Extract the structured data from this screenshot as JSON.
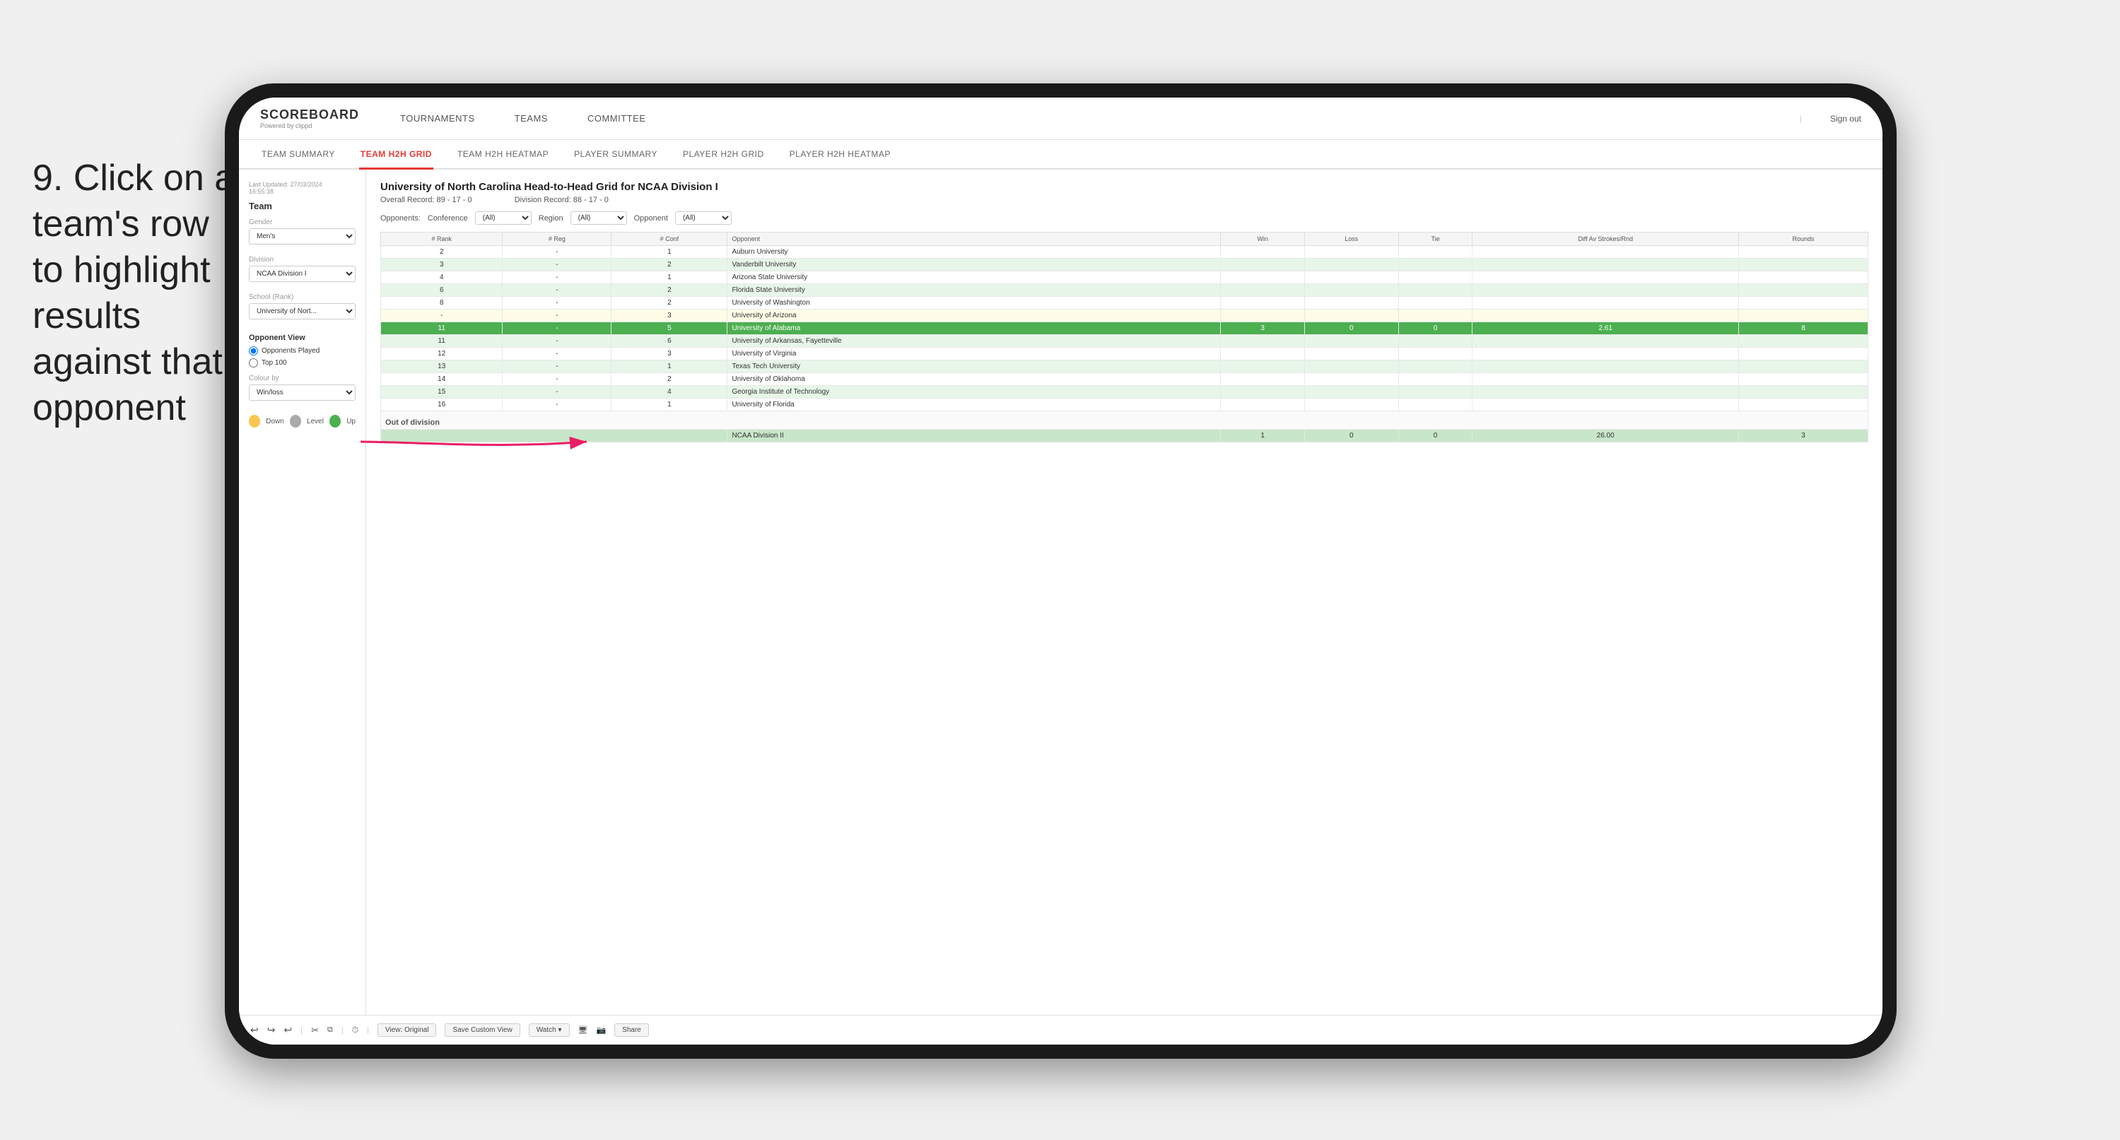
{
  "instruction": {
    "text": "9. Click on a team's row to highlight results against that opponent"
  },
  "nav": {
    "logo": "SCOREBOARD",
    "logo_sub": "Powered by clippd",
    "items": [
      "TOURNAMENTS",
      "TEAMS",
      "COMMITTEE"
    ],
    "sign_out": "Sign out"
  },
  "sub_nav": {
    "items": [
      "TEAM SUMMARY",
      "TEAM H2H GRID",
      "TEAM H2H HEATMAP",
      "PLAYER SUMMARY",
      "PLAYER H2H GRID",
      "PLAYER H2H HEATMAP"
    ],
    "active": "TEAM H2H GRID"
  },
  "sidebar": {
    "last_updated": "Last Updated: 27/03/2024",
    "last_updated_time": "16:55:38",
    "team_label": "Team",
    "gender_label": "Gender",
    "gender_value": "Men's",
    "division_label": "Division",
    "division_value": "NCAA Division I",
    "school_label": "School (Rank)",
    "school_value": "University of Nort...",
    "opponent_view_label": "Opponent View",
    "opponents_played": "Opponents Played",
    "top_100": "Top 100",
    "colour_by_label": "Colour by",
    "colour_by_value": "Win/loss",
    "legend": {
      "down_label": "Down",
      "level_label": "Level",
      "up_label": "Up"
    }
  },
  "grid": {
    "title": "University of North Carolina Head-to-Head Grid for NCAA Division I",
    "overall_record_label": "Overall Record:",
    "overall_record": "89 - 17 - 0",
    "division_record_label": "Division Record:",
    "division_record": "88 - 17 - 0",
    "filters": {
      "opponents_label": "Opponents:",
      "conference_label": "Conference",
      "conference_value": "(All)",
      "region_label": "Region",
      "region_value": "(All)",
      "opponent_label": "Opponent",
      "opponent_value": "(All)"
    },
    "columns": [
      "# Rank",
      "# Reg",
      "# Conf",
      "Opponent",
      "Win",
      "Loss",
      "Tie",
      "Diff Av Strokes/Rnd",
      "Rounds"
    ],
    "rows": [
      {
        "rank": "2",
        "reg": "-",
        "conf": "1",
        "opponent": "Auburn University",
        "win": "",
        "loss": "",
        "tie": "",
        "diff": "",
        "rounds": "",
        "highlight": "none"
      },
      {
        "rank": "3",
        "reg": "-",
        "conf": "2",
        "opponent": "Vanderbilt University",
        "win": "",
        "loss": "",
        "tie": "",
        "diff": "",
        "rounds": "",
        "highlight": "light-green"
      },
      {
        "rank": "4",
        "reg": "-",
        "conf": "1",
        "opponent": "Arizona State University",
        "win": "",
        "loss": "",
        "tie": "",
        "diff": "",
        "rounds": "",
        "highlight": "none"
      },
      {
        "rank": "6",
        "reg": "-",
        "conf": "2",
        "opponent": "Florida State University",
        "win": "",
        "loss": "",
        "tie": "",
        "diff": "",
        "rounds": "",
        "highlight": "light-green"
      },
      {
        "rank": "8",
        "reg": "-",
        "conf": "2",
        "opponent": "University of Washington",
        "win": "",
        "loss": "",
        "tie": "",
        "diff": "",
        "rounds": "",
        "highlight": "none"
      },
      {
        "rank": "-",
        "reg": "-",
        "conf": "3",
        "opponent": "University of Arizona",
        "win": "",
        "loss": "",
        "tie": "",
        "diff": "",
        "rounds": "",
        "highlight": "light-yellow"
      },
      {
        "rank": "11",
        "reg": "-",
        "conf": "5",
        "opponent": "University of Alabama",
        "win": "3",
        "loss": "0",
        "tie": "0",
        "diff": "2.61",
        "rounds": "8",
        "highlight": "green"
      },
      {
        "rank": "11",
        "reg": "-",
        "conf": "6",
        "opponent": "University of Arkansas, Fayetteville",
        "win": "",
        "loss": "",
        "tie": "",
        "diff": "",
        "rounds": "",
        "highlight": "light-green"
      },
      {
        "rank": "12",
        "reg": "-",
        "conf": "3",
        "opponent": "University of Virginia",
        "win": "",
        "loss": "",
        "tie": "",
        "diff": "",
        "rounds": "",
        "highlight": "none"
      },
      {
        "rank": "13",
        "reg": "-",
        "conf": "1",
        "opponent": "Texas Tech University",
        "win": "",
        "loss": "",
        "tie": "",
        "diff": "",
        "rounds": "",
        "highlight": "light-green"
      },
      {
        "rank": "14",
        "reg": "-",
        "conf": "2",
        "opponent": "University of Oklahoma",
        "win": "",
        "loss": "",
        "tie": "",
        "diff": "",
        "rounds": "",
        "highlight": "none"
      },
      {
        "rank": "15",
        "reg": "-",
        "conf": "4",
        "opponent": "Georgia Institute of Technology",
        "win": "",
        "loss": "",
        "tie": "",
        "diff": "",
        "rounds": "",
        "highlight": "light-green"
      },
      {
        "rank": "16",
        "reg": "-",
        "conf": "1",
        "opponent": "University of Florida",
        "win": "",
        "loss": "",
        "tie": "",
        "diff": "",
        "rounds": "",
        "highlight": "none"
      }
    ],
    "out_of_division_label": "Out of division",
    "division_row": {
      "label": "NCAA Division II",
      "win": "1",
      "loss": "0",
      "tie": "0",
      "diff": "26.00",
      "rounds": "3"
    }
  },
  "toolbar": {
    "undo": "↩",
    "redo": "↪",
    "view_original": "View: Original",
    "save_custom": "Save Custom View",
    "watch": "Watch ▾",
    "share": "Share"
  }
}
